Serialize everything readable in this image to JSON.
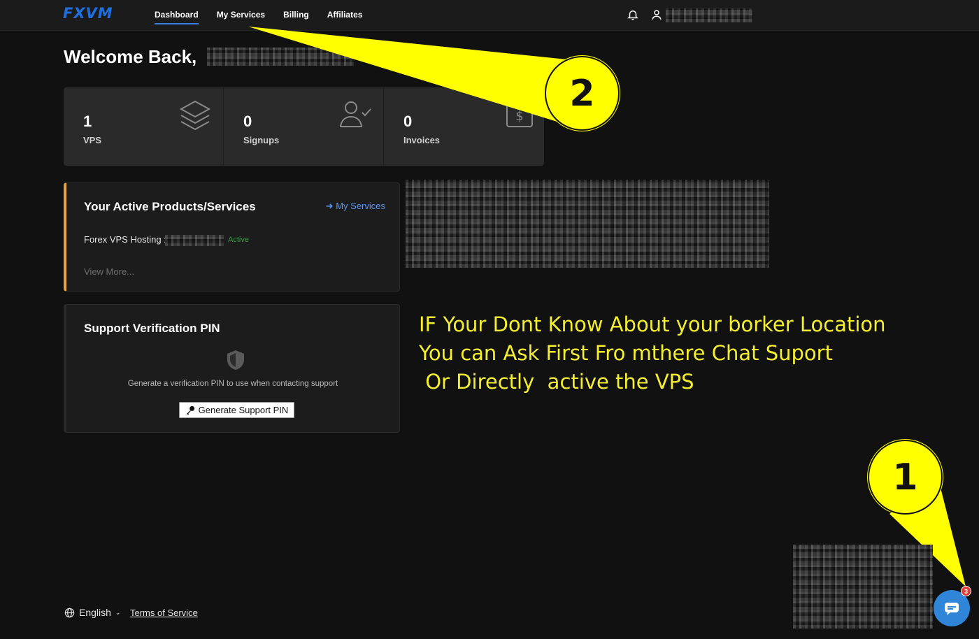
{
  "brand": {
    "logo_text": "FXVM",
    "accent": "#1e6fe0"
  },
  "nav": {
    "items": [
      {
        "label": "Dashboard",
        "active": true
      },
      {
        "label": "My Services",
        "active": false
      },
      {
        "label": "Billing",
        "active": false
      },
      {
        "label": "Affiliates",
        "active": false
      }
    ]
  },
  "header": {
    "notifications_icon": "bell-icon",
    "user_icon": "user-icon"
  },
  "welcome": {
    "title": "Welcome Back,"
  },
  "stats": [
    {
      "value": "1",
      "label": "VPS",
      "icon": "layers-icon"
    },
    {
      "value": "0",
      "label": "Signups",
      "icon": "user-check-icon"
    },
    {
      "value": "0",
      "label": "Invoices",
      "icon": "invoice-dollar-icon"
    }
  ],
  "products": {
    "title": "Your Active Products/Services",
    "link": "My Services",
    "items": [
      {
        "name": "Forex VPS Hosting :",
        "status": "Active"
      }
    ],
    "view_more": "View More...",
    "accent": "#e8a33a",
    "status_color": "#3a9a46"
  },
  "support_pin": {
    "title": "Support Verification PIN",
    "description": "Generate a verification PIN to use when contacting support",
    "button": "Generate Support PIN"
  },
  "annotation": {
    "lines": [
      "IF Your Dont Know About your borker Location",
      "You can Ask First Fro mthere Chat Suport",
      " Or Directly  active the VPS"
    ],
    "callout_1": "1",
    "callout_2": "2",
    "color": "#f4ef2f"
  },
  "footer": {
    "language": "English",
    "terms": "Terms of Service"
  },
  "chat": {
    "badge_count": "3",
    "button_color": "#2f86d8"
  }
}
